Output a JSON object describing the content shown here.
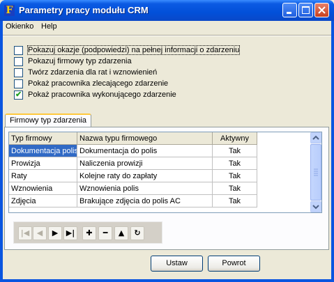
{
  "window": {
    "title": "Parametry pracy modułu CRM",
    "app_icon_letter": "F"
  },
  "menu": [
    {
      "label": "Okienko"
    },
    {
      "label": "Help"
    }
  ],
  "options": [
    {
      "label": "Pokazuj okazje (podpowiedzi) na pełnej informacji o zdarzeniu",
      "checked": false
    },
    {
      "label": "Pokazuj firmowy typ zdarzenia",
      "checked": false
    },
    {
      "label": "Twórz zdarzenia dla rat i wznowienień",
      "checked": false
    },
    {
      "label": "Pokaż pracownika zlecającego zdarzenie",
      "checked": false
    },
    {
      "label": "Pokaż pracownika wykonującego zdarzenie",
      "checked": true
    }
  ],
  "tab": {
    "label": "Firmowy typ zdarzenia"
  },
  "grid": {
    "columns": [
      "Typ firmowy",
      "Nazwa typu firmowego",
      "Aktywny"
    ],
    "rows": [
      [
        "Dokumentacja polis",
        "Dokumentacja do polis",
        "Tak"
      ],
      [
        "Prowizja",
        "Naliczenia prowizji",
        "Tak"
      ],
      [
        "Raty",
        "Kolejne raty do zapłaty",
        "Tak"
      ],
      [
        "Wznowienia",
        "Wznowienia polis",
        "Tak"
      ],
      [
        "Zdjęcia",
        "Brakujące zdjęcia do polis AC",
        "Tak"
      ]
    ]
  },
  "navigator": {
    "buttons": [
      {
        "icon": "first-record-icon",
        "glyph": "|◀",
        "enabled": false
      },
      {
        "icon": "prior-record-icon",
        "glyph": "◀",
        "enabled": false
      },
      {
        "icon": "next-record-icon",
        "glyph": "▶",
        "enabled": true
      },
      {
        "icon": "last-record-icon",
        "glyph": "▶|",
        "enabled": true
      },
      {
        "icon": "insert-icon",
        "glyph": "✚",
        "enabled": true
      },
      {
        "icon": "delete-icon",
        "glyph": "━",
        "enabled": true
      },
      {
        "icon": "edit-icon",
        "glyph": "▲",
        "enabled": true
      },
      {
        "icon": "refresh-icon",
        "glyph": "↻",
        "enabled": true
      }
    ]
  },
  "buttons": {
    "ustaw": "Ustaw",
    "powrot": "Powrot"
  },
  "colors": {
    "title_bar": "#0250d9",
    "selection": "#316ac5",
    "check": "#21a121"
  }
}
